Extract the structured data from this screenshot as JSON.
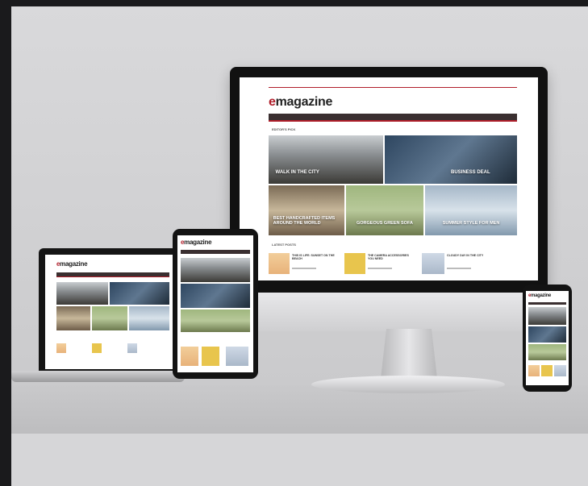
{
  "site": {
    "logo_prefix": "e",
    "logo_rest": "magazine"
  },
  "monitor": {
    "section_featured": "Editor's Pick",
    "tiles": [
      "Walk in the City",
      "Business Deal",
      "Best Handcrafted Items Around The World",
      "Gorgeous Green Sofa",
      "Summer Style For Men"
    ],
    "section_latest": "Latest Posts",
    "posts": [
      "This Is Life: Sunset On The Beach",
      "The Camera Accessories You Need",
      "Cloudy Day In The City"
    ]
  },
  "colors": {
    "accent": "#b01e2a",
    "nav": "#3a2f30",
    "background": "#d6d6d8"
  }
}
